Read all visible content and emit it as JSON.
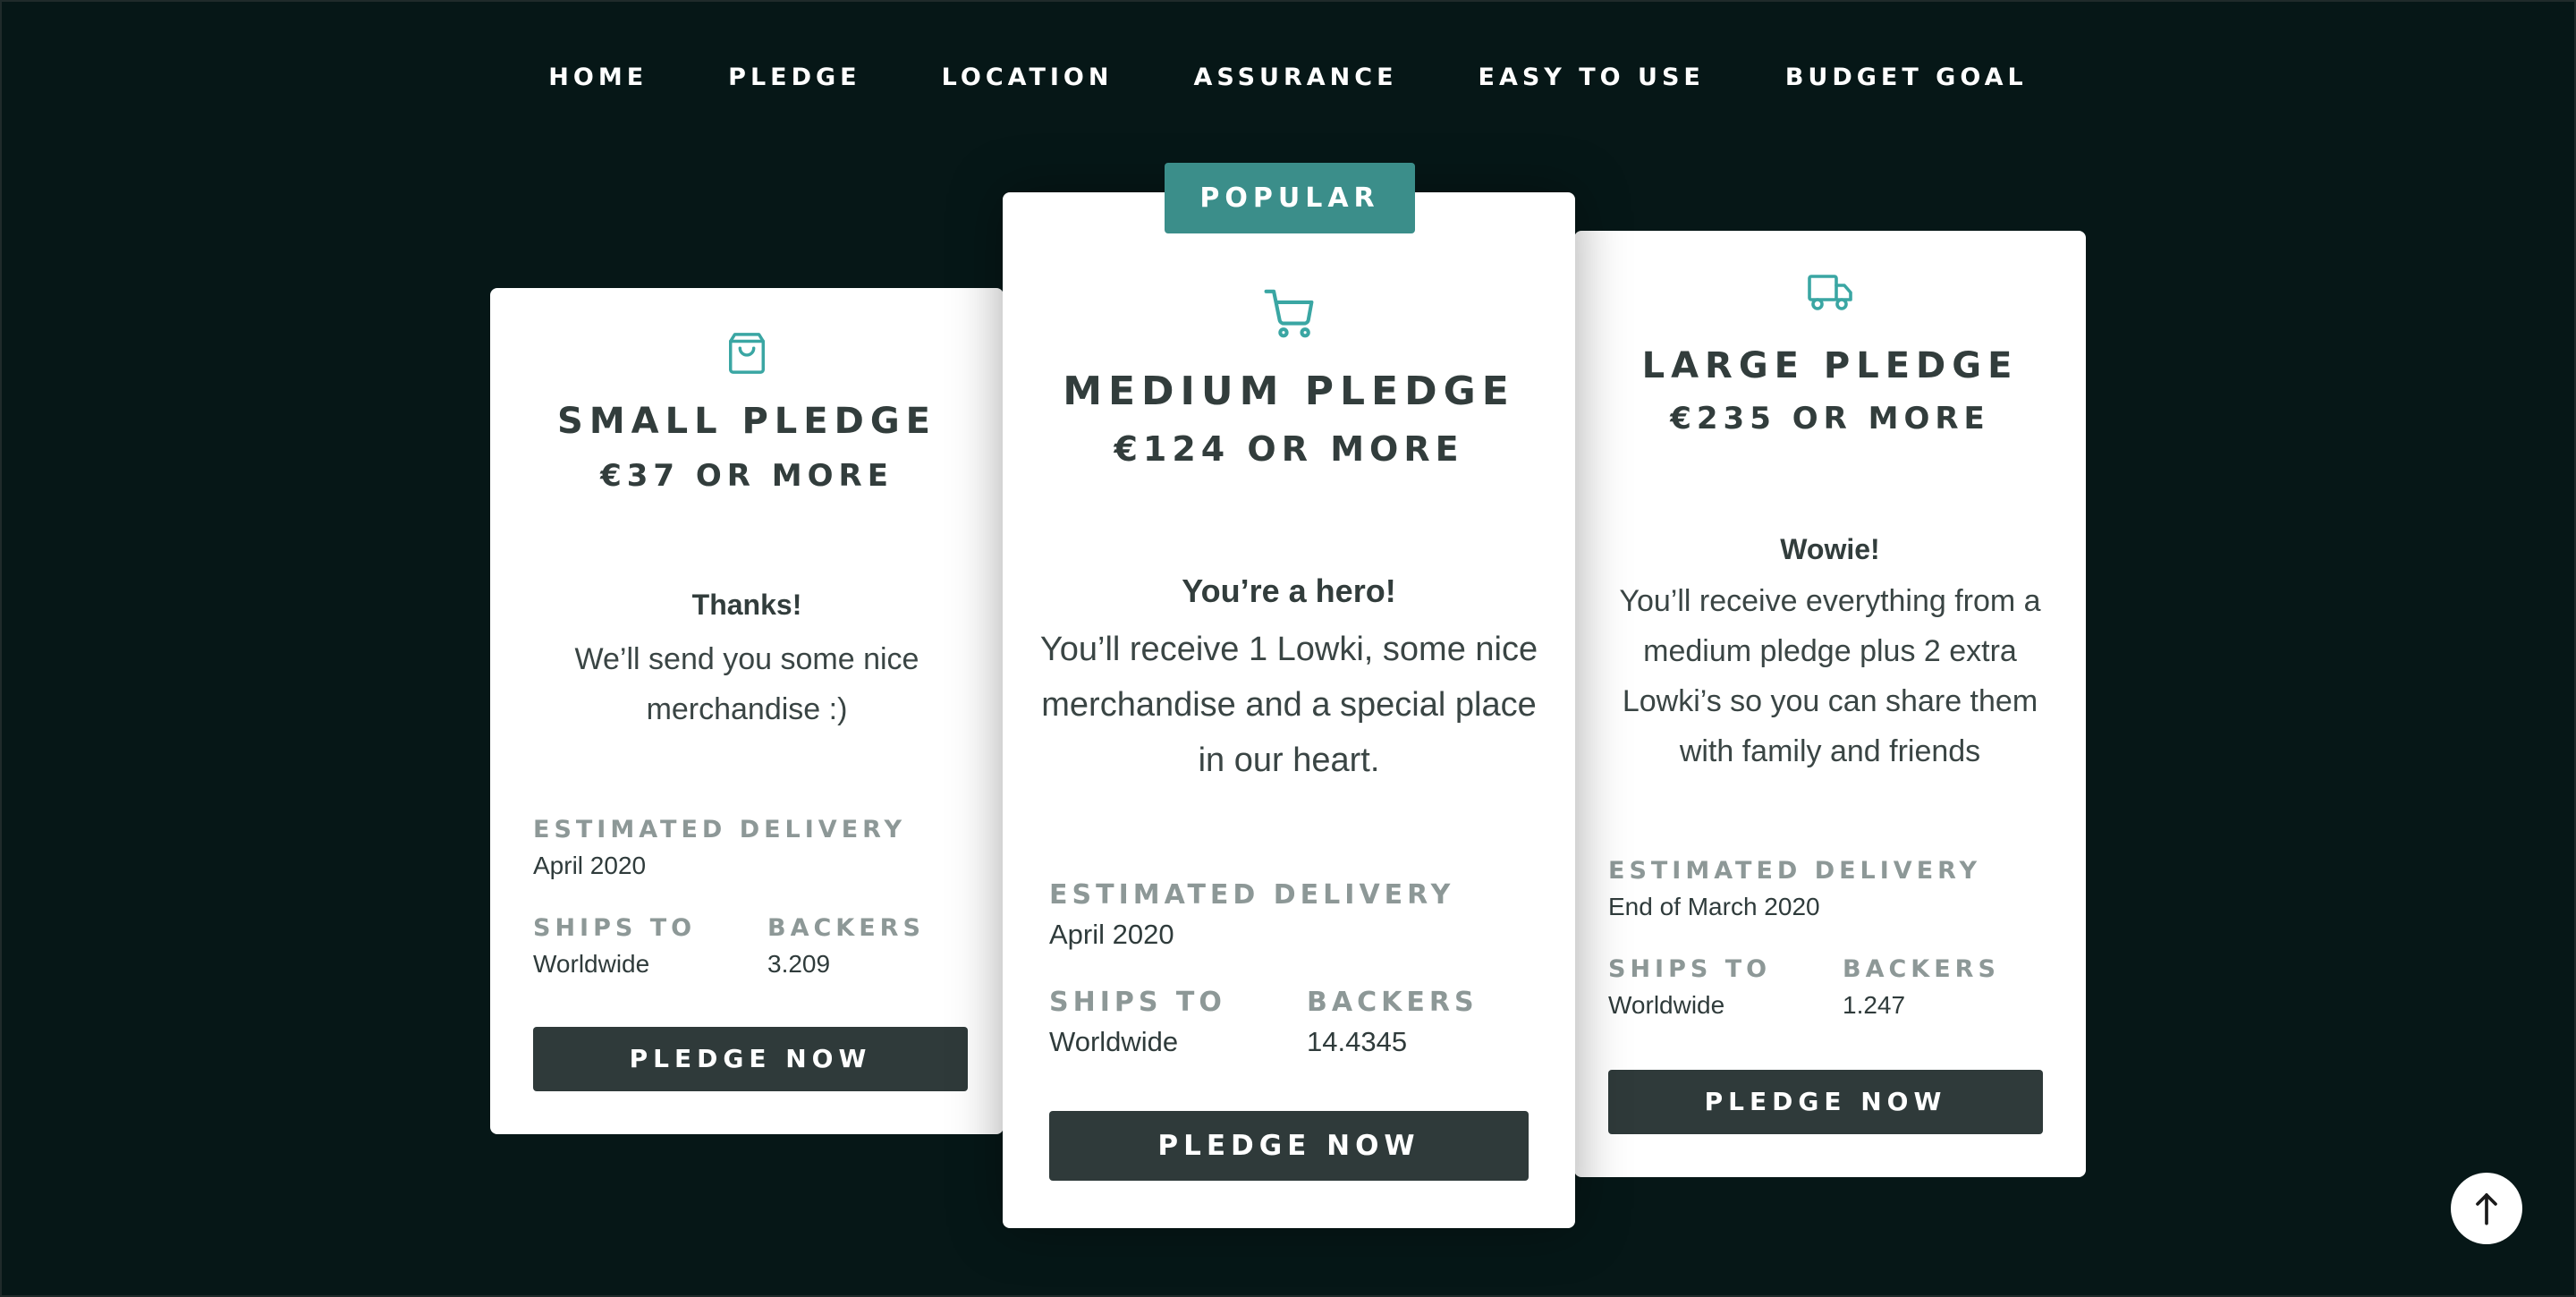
{
  "nav": {
    "items": [
      {
        "label": "HOME"
      },
      {
        "label": "PLEDGE"
      },
      {
        "label": "LOCATION"
      },
      {
        "label": "ASSURANCE"
      },
      {
        "label": "EASY TO USE"
      },
      {
        "label": "BUDGET GOAL"
      }
    ]
  },
  "colors": {
    "background": "#061717",
    "accent": "#3b8e8a",
    "icon": "#3aa6a3",
    "button": "#2f3a3a",
    "text": "#323d3c",
    "muted_label": "#8d9897"
  },
  "badge": {
    "label": "POPULAR"
  },
  "cards": {
    "small": {
      "icon": "shopping-bag-icon",
      "title": "SMALL PLEDGE",
      "price": "€37 OR MORE",
      "intro": "Thanks!",
      "description": "We’ll send you some nice merchandise :)",
      "delivery_label": "ESTIMATED DELIVERY",
      "delivery_value": "April 2020",
      "ships_label": "SHIPS TO",
      "ships_value": "Worldwide",
      "backers_label": "BACKERS",
      "backers_value": "3.209",
      "button_label": "PLEDGE NOW"
    },
    "medium": {
      "icon": "shopping-cart-icon",
      "title": "MEDIUM PLEDGE",
      "price": "€124 OR MORE",
      "intro": "You’re a hero!",
      "description": "You’ll receive 1 Lowki, some nice merchandise and a special place in our heart.",
      "delivery_label": "ESTIMATED DELIVERY",
      "delivery_value": "April 2020",
      "ships_label": "SHIPS TO",
      "ships_value": "Worldwide",
      "backers_label": "BACKERS",
      "backers_value": "14.4345",
      "button_label": "PLEDGE NOW"
    },
    "large": {
      "icon": "truck-icon",
      "title": "LARGE PLEDGE",
      "price": "€235 OR MORE",
      "intro": "Wowie!",
      "description": "You’ll receive everything from a medium pledge plus 2 extra Lowki’s so you can share them with family and friends",
      "delivery_label": "ESTIMATED DELIVERY",
      "delivery_value": "End of March 2020",
      "ships_label": "SHIPS TO",
      "ships_value": "Worldwide",
      "backers_label": "BACKERS",
      "backers_value": "1.247",
      "button_label": "PLEDGE NOW"
    }
  },
  "scroll_top": {
    "icon": "arrow-up-icon"
  }
}
